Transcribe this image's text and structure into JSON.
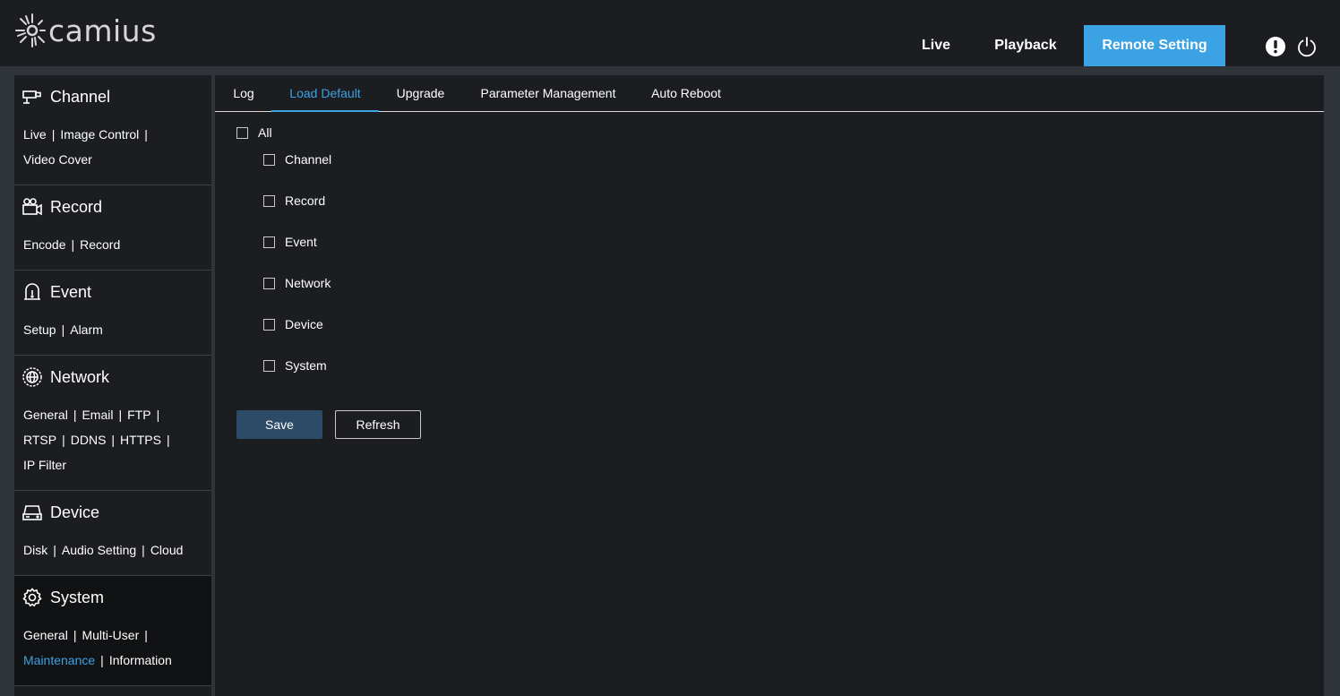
{
  "header": {
    "brand": "camius",
    "nav": {
      "live": "Live",
      "playback": "Playback",
      "remote_setting": "Remote Setting"
    },
    "icons": [
      "alert-icon",
      "power-icon"
    ],
    "accent": "#3ba2e3"
  },
  "sidebar": {
    "channel": {
      "title": "Channel",
      "links": [
        "Live",
        "Image Control",
        "Video Cover"
      ]
    },
    "record": {
      "title": "Record",
      "links": [
        "Encode",
        "Record"
      ]
    },
    "event": {
      "title": "Event",
      "links": [
        "Setup",
        "Alarm"
      ]
    },
    "network": {
      "title": "Network",
      "links": [
        "General",
        "Email",
        "FTP",
        "RTSP",
        "DDNS",
        "HTTPS",
        "IP Filter"
      ]
    },
    "device": {
      "title": "Device",
      "links": [
        "Disk",
        "Audio Setting",
        "Cloud"
      ]
    },
    "system": {
      "title": "System",
      "links": [
        "General",
        "Multi-User",
        "Maintenance",
        "Information"
      ],
      "active_link": "Maintenance"
    },
    "separator": "|"
  },
  "tabs": [
    "Log",
    "Load Default",
    "Upgrade",
    "Parameter Management",
    "Auto Reboot"
  ],
  "active_tab": "Load Default",
  "load_default": {
    "all_label": "All",
    "options": [
      "Channel",
      "Record",
      "Event",
      "Network",
      "Device",
      "System"
    ]
  },
  "buttons": {
    "save": "Save",
    "refresh": "Refresh"
  }
}
